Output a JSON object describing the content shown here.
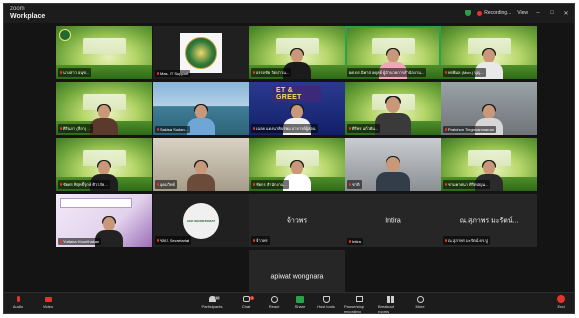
{
  "app": {
    "brand_top": "zoom",
    "brand_name": "Workplace"
  },
  "titlebar": {
    "recording": "Recording...",
    "view": "View",
    "min": "–",
    "max": "□",
    "close": "✕"
  },
  "tiles": [
    {
      "id": "t1",
      "label": "นางสาว อนุช..."
    },
    {
      "id": "t2",
      "label": "Mas. IT Support"
    },
    {
      "id": "t3",
      "label": "อรรถชัย วัดปาวน..."
    },
    {
      "id": "t4",
      "label": "ผศ.ดร.นิพาส อดุลย์ ผู้อำนวยการสำนักงาน...",
      "active": true
    },
    {
      "id": "t5",
      "label": "พรพิมล (Mon.) บุญ..."
    },
    {
      "id": "t6",
      "label": "ศิรินภา (ลีลา) ..."
    },
    {
      "id": "t7",
      "label": "Sakisa Sudan..."
    },
    {
      "id": "t8",
      "label": "ET & GREET",
      "badge": "ET & GREET",
      "label2": "เฉลย แดงนาคิบรพม อาจารย์ผู้สอน"
    },
    {
      "id": "t9",
      "label": "ศิริพร แก้วยัน..."
    },
    {
      "id": "t10",
      "label": "Pratchon Tiegnnanmarrun"
    },
    {
      "id": "t11",
      "label": "ชัยศร พิสุทธิ์รุกษ์ ศิวาภัย..."
    },
    {
      "id": "t12",
      "label": "อุดมวิทย์"
    },
    {
      "id": "t13",
      "label": "ชัยกร สำนักงาน..."
    },
    {
      "id": "t14",
      "label": "ชาติ"
    },
    {
      "id": "t15",
      "label": "ชามคาศนา ศิริตปญน..."
    },
    {
      "id": "t16",
      "label": "Yuttana Hoonthakan"
    },
    {
      "id": "t17",
      "label": "ชจป. Secretariat",
      "logo_text": "ASO SECRETARIAT"
    },
    {
      "id": "t18",
      "name": "จ้าวพร",
      "label": "จ้าวพร"
    },
    {
      "id": "t19",
      "name": "Intira",
      "label": "Intira"
    },
    {
      "id": "t20",
      "name": "ณ.สุภาพร มะรัตน์...",
      "label": "ณ.สุภาพร มะรัตน์ ดร.ปู"
    },
    {
      "id": "t21",
      "name": "apiwat wongnara",
      "label": "apiwat wongnara"
    }
  ],
  "toolbar": {
    "audio": "Audio",
    "video": "Video",
    "participants": "Participants",
    "participants_count": "12",
    "chat": "Chat",
    "chat_badge": "1",
    "react": "React",
    "share": "Share",
    "host_tools": "Host tools",
    "pause_stop": "Pause/stop recording",
    "breakout": "Breakout rooms",
    "more": "More",
    "end": "End"
  }
}
